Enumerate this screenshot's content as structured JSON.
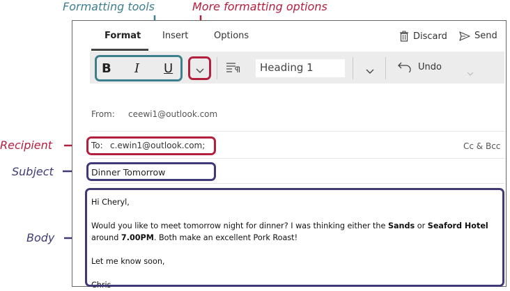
{
  "callouts": {
    "formatting_tools": "Formatting tools",
    "more_formatting_options": "More formatting options",
    "recipient": "Recipient",
    "subject": "Subject",
    "body": "Body"
  },
  "tabs": [
    "Format",
    "Insert",
    "Options"
  ],
  "actions": {
    "discard": "Discard",
    "send": "Send"
  },
  "toolbar": {
    "bold": "B",
    "italic": "I",
    "underline": "U",
    "style_value": "Heading 1",
    "undo": "Undo"
  },
  "from": {
    "label": "From:",
    "value": "ceewi1@outlook.com"
  },
  "to": {
    "label": "To:",
    "value": "c.ewin1@outlook.com;",
    "cc_bcc": "Cc & Bcc"
  },
  "subject": "Dinner Tomorrow",
  "body": {
    "greeting": "Hi Cheryl,",
    "line1_a": "Would you like to meet tomorrow night for dinner?  I was thinking either the ",
    "line1_b": "Sands",
    "line1_c": " or ",
    "line1_d": "Seaford Hotel",
    "line2_a": "around ",
    "line2_b": "7.00PM",
    "line2_c": ".  Both make an excellent Pork Roast!",
    "line3": "Let me know soon,",
    "signature": "Chris"
  },
  "colors": {
    "teal": "#3e7f8e",
    "red": "#b3203e",
    "navy": "#3f3a75"
  }
}
